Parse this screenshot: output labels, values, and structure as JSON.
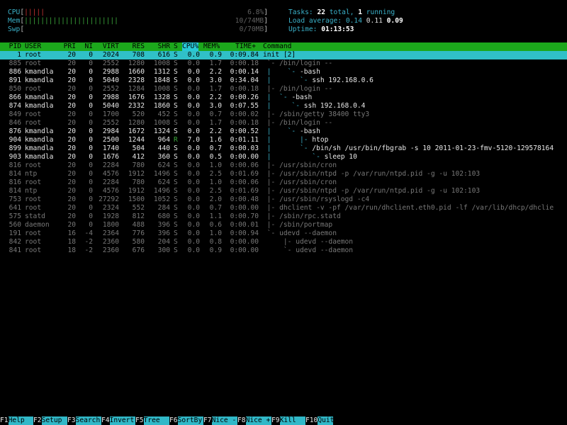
{
  "meters": {
    "cpu": {
      "label": "CPU",
      "bars": "|||||",
      "value": "6.8%"
    },
    "mem": {
      "label": "Mem",
      "bars": "|||||||||||||||||||||||",
      "value": "10/74MB"
    },
    "swp": {
      "label": "Swp",
      "bars": "",
      "value": "0/70MB"
    }
  },
  "summary": {
    "tasks_label": "Tasks:",
    "tasks_total": "22",
    "tasks_total_word": "total,",
    "tasks_running": "1",
    "tasks_running_word": "running",
    "load_label": "Load average:",
    "load1": "0.14",
    "load5": "0.11",
    "load15": "0.09",
    "uptime_label": "Uptime:",
    "uptime": "01:13:53"
  },
  "header": {
    "pid": "PID",
    "user": "USER",
    "pri": "PRI",
    "ni": "NI",
    "virt": "VIRT",
    "res": "RES",
    "shr": "SHR",
    "s": "S",
    "cpu": "CPU%",
    "mem": "MEM%",
    "time": "TIME+",
    "command": "Command"
  },
  "processes": [
    {
      "pid": "1",
      "user": "root",
      "pri": "20",
      "ni": "0",
      "virt": "2024",
      "res": "708",
      "shr": "616",
      "s": "S",
      "cpu": "0.0",
      "mem": "0.9",
      "time": "0:09.84",
      "tree": "",
      "cmd": "init [2]",
      "style": "sel"
    },
    {
      "pid": "885",
      "user": "root",
      "pri": "20",
      "ni": "0",
      "virt": "2552",
      "res": "1280",
      "shr": "1008",
      "s": "S",
      "cpu": "0.0",
      "mem": "1.7",
      "time": "0:00.18",
      "tree": " `- ",
      "cmd": "/bin/login --",
      "style": "dim"
    },
    {
      "pid": "886",
      "user": "kmandla",
      "pri": "20",
      "ni": "0",
      "virt": "2988",
      "res": "1660",
      "shr": "1312",
      "s": "S",
      "cpu": "0.0",
      "mem": "2.2",
      "time": "0:00.14",
      "tree": " |    `- ",
      "cmd": "-bash",
      "style": "bright"
    },
    {
      "pid": "891",
      "user": "kmandla",
      "pri": "20",
      "ni": "0",
      "virt": "5040",
      "res": "2328",
      "shr": "1848",
      "s": "S",
      "cpu": "0.0",
      "mem": "3.0",
      "time": "0:34.04",
      "tree": " |       `- ",
      "cmd": "ssh 192.168.0.6",
      "style": "bright"
    },
    {
      "pid": "850",
      "user": "root",
      "pri": "20",
      "ni": "0",
      "virt": "2552",
      "res": "1284",
      "shr": "1008",
      "s": "S",
      "cpu": "0.0",
      "mem": "1.7",
      "time": "0:00.18",
      "tree": " |- ",
      "cmd": "/bin/login --",
      "style": "dim"
    },
    {
      "pid": "866",
      "user": "kmandla",
      "pri": "20",
      "ni": "0",
      "virt": "2988",
      "res": "1676",
      "shr": "1328",
      "s": "S",
      "cpu": "0.0",
      "mem": "2.2",
      "time": "0:00.26",
      "tree": " |  `- ",
      "cmd": "-bash",
      "style": "bright"
    },
    {
      "pid": "874",
      "user": "kmandla",
      "pri": "20",
      "ni": "0",
      "virt": "5040",
      "res": "2332",
      "shr": "1860",
      "s": "S",
      "cpu": "0.0",
      "mem": "3.0",
      "time": "0:07.55",
      "tree": " |     `- ",
      "cmd": "ssh 192.168.0.4",
      "style": "bright"
    },
    {
      "pid": "849",
      "user": "root",
      "pri": "20",
      "ni": "0",
      "virt": "1700",
      "res": "520",
      "shr": "452",
      "s": "S",
      "cpu": "0.0",
      "mem": "0.7",
      "time": "0:00.02",
      "tree": " |- ",
      "cmd": "/sbin/getty 38400 tty3",
      "style": "dim"
    },
    {
      "pid": "846",
      "user": "root",
      "pri": "20",
      "ni": "0",
      "virt": "2552",
      "res": "1280",
      "shr": "1008",
      "s": "S",
      "cpu": "0.0",
      "mem": "1.7",
      "time": "0:00.18",
      "tree": " |- ",
      "cmd": "/bin/login --",
      "style": "dim"
    },
    {
      "pid": "876",
      "user": "kmandla",
      "pri": "20",
      "ni": "0",
      "virt": "2984",
      "res": "1672",
      "shr": "1324",
      "s": "S",
      "cpu": "0.0",
      "mem": "2.2",
      "time": "0:00.52",
      "tree": " |    `- ",
      "cmd": "-bash",
      "style": "bright"
    },
    {
      "pid": "904",
      "user": "kmandla",
      "pri": "20",
      "ni": "0",
      "virt": "2500",
      "res": "1244",
      "shr": "964",
      "s": "R",
      "cpu": "7.0",
      "mem": "1.6",
      "time": "0:01.11",
      "tree": " |       |- ",
      "cmd": "htop",
      "style": "bright"
    },
    {
      "pid": "899",
      "user": "kmandla",
      "pri": "20",
      "ni": "0",
      "virt": "1740",
      "res": "504",
      "shr": "440",
      "s": "S",
      "cpu": "0.0",
      "mem": "0.7",
      "time": "0:00.03",
      "tree": " |       `- ",
      "cmd": "/bin/sh /usr/bin/fbgrab -s 10 2011-01-23-fmv-5120-129578164",
      "style": "bright"
    },
    {
      "pid": "903",
      "user": "kmandla",
      "pri": "20",
      "ni": "0",
      "virt": "1676",
      "res": "412",
      "shr": "360",
      "s": "S",
      "cpu": "0.0",
      "mem": "0.5",
      "time": "0:00.00",
      "tree": " |          `- ",
      "cmd": "sleep 10",
      "style": "bright"
    },
    {
      "pid": "816",
      "user": "root",
      "pri": "20",
      "ni": "0",
      "virt": "2284",
      "res": "780",
      "shr": "624",
      "s": "S",
      "cpu": "0.0",
      "mem": "1.0",
      "time": "0:00.06",
      "tree": " |- ",
      "cmd": "/usr/sbin/cron",
      "style": "dim"
    },
    {
      "pid": "814",
      "user": "ntp",
      "pri": "20",
      "ni": "0",
      "virt": "4576",
      "res": "1912",
      "shr": "1496",
      "s": "S",
      "cpu": "0.0",
      "mem": "2.5",
      "time": "0:01.69",
      "tree": " |- ",
      "cmd": "/usr/sbin/ntpd -p /var/run/ntpd.pid -g -u 102:103",
      "style": "dim"
    },
    {
      "pid": "816",
      "user": "root",
      "pri": "20",
      "ni": "0",
      "virt": "2284",
      "res": "780",
      "shr": "624",
      "s": "S",
      "cpu": "0.0",
      "mem": "1.0",
      "time": "0:00.06",
      "tree": " |- ",
      "cmd": "/usr/sbin/cron",
      "style": "dim"
    },
    {
      "pid": "814",
      "user": "ntp",
      "pri": "20",
      "ni": "0",
      "virt": "4576",
      "res": "1912",
      "shr": "1496",
      "s": "S",
      "cpu": "0.0",
      "mem": "2.5",
      "time": "0:01.69",
      "tree": " |- ",
      "cmd": "/usr/sbin/ntpd -p /var/run/ntpd.pid -g -u 102:103",
      "style": "dim"
    },
    {
      "pid": "753",
      "user": "root",
      "pri": "20",
      "ni": "0",
      "virt": "27292",
      "res": "1500",
      "shr": "1052",
      "s": "S",
      "cpu": "0.0",
      "mem": "2.0",
      "time": "0:00.48",
      "tree": " |- ",
      "cmd": "/usr/sbin/rsyslogd -c4",
      "style": "dim"
    },
    {
      "pid": "641",
      "user": "root",
      "pri": "20",
      "ni": "0",
      "virt": "2324",
      "res": "552",
      "shr": "284",
      "s": "S",
      "cpu": "0.0",
      "mem": "0.7",
      "time": "0:00.00",
      "tree": " |- ",
      "cmd": "dhclient -v -pf /var/run/dhclient.eth0.pid -lf /var/lib/dhcp/dhclie",
      "style": "dim"
    },
    {
      "pid": "575",
      "user": "statd",
      "pri": "20",
      "ni": "0",
      "virt": "1928",
      "res": "812",
      "shr": "680",
      "s": "S",
      "cpu": "0.0",
      "mem": "1.1",
      "time": "0:00.70",
      "tree": " |- ",
      "cmd": "/sbin/rpc.statd",
      "style": "dim"
    },
    {
      "pid": "560",
      "user": "daemon",
      "pri": "20",
      "ni": "0",
      "virt": "1800",
      "res": "488",
      "shr": "396",
      "s": "S",
      "cpu": "0.0",
      "mem": "0.6",
      "time": "0:00.01",
      "tree": " |- ",
      "cmd": "/sbin/portmap",
      "style": "dim"
    },
    {
      "pid": "191",
      "user": "root",
      "pri": "16",
      "ni": "-4",
      "virt": "2364",
      "res": "776",
      "shr": "396",
      "s": "S",
      "cpu": "0.0",
      "mem": "1.0",
      "time": "0:00.94",
      "tree": " `- ",
      "cmd": "udevd --daemon",
      "style": "dim"
    },
    {
      "pid": "842",
      "user": "root",
      "pri": "18",
      "ni": "-2",
      "virt": "2360",
      "res": "580",
      "shr": "204",
      "s": "S",
      "cpu": "0.0",
      "mem": "0.8",
      "time": "0:00.00",
      "tree": "     |- ",
      "cmd": "udevd --daemon",
      "style": "dim"
    },
    {
      "pid": "841",
      "user": "root",
      "pri": "18",
      "ni": "-2",
      "virt": "2360",
      "res": "676",
      "shr": "300",
      "s": "S",
      "cpu": "0.0",
      "mem": "0.9",
      "time": "0:00.00",
      "tree": "     `- ",
      "cmd": "udevd --daemon",
      "style": "dim"
    }
  ],
  "footer": [
    {
      "key": "F1",
      "label": "Help"
    },
    {
      "key": "F2",
      "label": "Setup"
    },
    {
      "key": "F3",
      "label": "Search"
    },
    {
      "key": "F4",
      "label": "Invert"
    },
    {
      "key": "F5",
      "label": "Tree"
    },
    {
      "key": "F6",
      "label": "SortBy"
    },
    {
      "key": "F7",
      "label": "Nice -"
    },
    {
      "key": "F8",
      "label": "Nice +"
    },
    {
      "key": "F9",
      "label": "Kill"
    },
    {
      "key": "F10",
      "label": "Quit"
    }
  ]
}
